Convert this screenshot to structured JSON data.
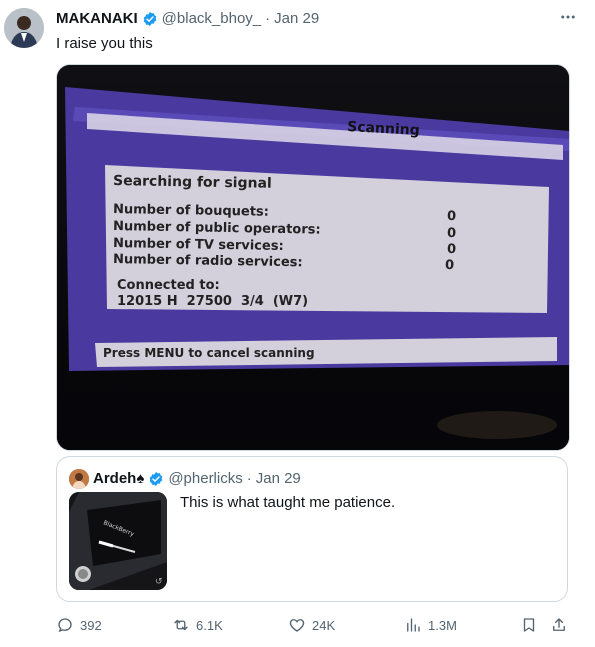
{
  "tweet": {
    "author_name": "MAKANAKI",
    "author_handle": "@black_bhoy_",
    "separator": "·",
    "date": "Jan 29",
    "text": "I raise you this",
    "more_icon": "more-horizontal-icon"
  },
  "screen": {
    "title": "Scanning",
    "searching": "Searching for signal",
    "rows": [
      {
        "label": "Number of bouquets:",
        "value": "0"
      },
      {
        "label": "Number of public operators:",
        "value": "0"
      },
      {
        "label": "Number of TV services:",
        "value": "0"
      },
      {
        "label": "Number of radio services:",
        "value": "0"
      }
    ],
    "connected_label": "Connected to:",
    "connected_value": "12015 H  27500  3/4  (W7)",
    "footer": "Press MENU to cancel scanning"
  },
  "quote": {
    "author_name": "Ardeh♠",
    "author_handle": "@pherlicks",
    "separator": "·",
    "date": "Jan 29",
    "text": "This is what taught me patience.",
    "thumb_text": "BlackBerry"
  },
  "actions": {
    "replies": "392",
    "reposts": "6.1K",
    "likes": "24K",
    "views": "1.3M"
  },
  "colors": {
    "verified": "#1d9bf0",
    "muted": "#536471",
    "border": "#cfd9de",
    "tv_purple": "#4a3aa0"
  }
}
